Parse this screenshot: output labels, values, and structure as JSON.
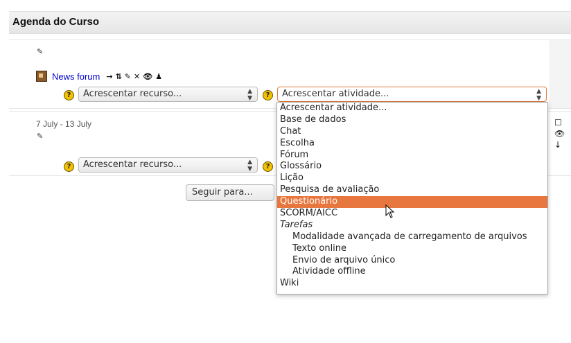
{
  "header": {
    "title": "Agenda do Curso"
  },
  "topic0": {
    "edit_icon": "pencil-icon",
    "forum_link": "News forum",
    "tool_icons": [
      "→",
      "⇅",
      "✎",
      "✕",
      "👁",
      "♟"
    ],
    "add_resource": "Acrescentar recurso...",
    "add_activity": "Acrescentar atividade..."
  },
  "topic1": {
    "date_range": "7 July - 13 July",
    "add_resource": "Acrescentar recurso..."
  },
  "jump_button": "Seguir para...",
  "help_glyph": "?",
  "activity_dropdown": {
    "options": [
      "Acrescentar atividade...",
      "Base de dados",
      "Chat",
      "Escolha",
      "Fórum",
      "Glossário",
      "Lição",
      "Pesquisa de avaliação",
      "Questionário",
      "SCORM/AICC",
      "Tarefas",
      "Modalidade avançada de carregamento de arquivos",
      "Texto online",
      "Envio de arquivo único",
      "Atividade offline",
      "Wiki"
    ],
    "highlighted": "Questionário",
    "accent_color": "#e8773f"
  }
}
